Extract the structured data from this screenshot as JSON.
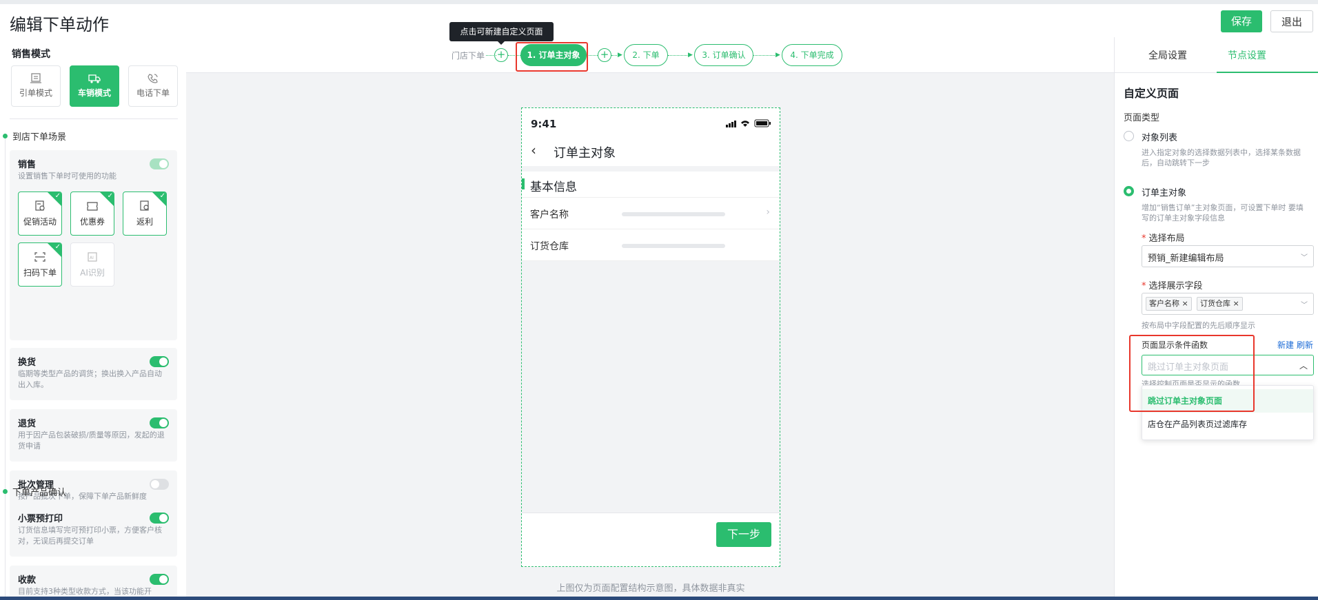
{
  "header": {
    "title": "编辑下单动作",
    "save_label": "保存",
    "exit_label": "退出"
  },
  "left": {
    "section_title": "销售模式",
    "modes": [
      {
        "label": "引单模式",
        "icon": "order-icon"
      },
      {
        "label": "车销模式",
        "icon": "truck-icon",
        "active": true
      },
      {
        "label": "电话下单",
        "icon": "phone-icon"
      }
    ],
    "scene1": "到店下单场景",
    "sales": {
      "title": "销售",
      "desc": "设置销售下单时可使用的功能",
      "features": [
        "促销活动",
        "优惠券",
        "返利",
        "扫码下单",
        "AI识别"
      ]
    },
    "exchange": {
      "title": "换货",
      "desc": "临期等类型产品的调货；换出换入产品自动出入库。",
      "on": true
    },
    "returns": {
      "title": "退货",
      "desc": "用于因产品包装破损/质量等原因，发起的退货申请",
      "on": true
    },
    "batch": {
      "title": "批次管理",
      "desc": "按产品批次下单，保障下单产品新鲜度",
      "on": false
    },
    "scene2": "下单产品确认",
    "receipt": {
      "title": "小票预打印",
      "desc": "订货信息填写完可预打印小票，方便客户核对，无误后再提交订单",
      "on": true
    },
    "collect": {
      "title": "收款",
      "desc": "目前支持3种类型收款方式，当该功能开",
      "on": true
    }
  },
  "steps": {
    "tooltip": "点击可新建自定义页面",
    "store": "门店下单",
    "items": [
      "1. 订单主对象",
      "2. 下单",
      "3. 订单确认",
      "4. 下单完成"
    ]
  },
  "phone": {
    "time": "9:41",
    "title": "订单主对象",
    "section": "基本信息",
    "rows": [
      "客户名称",
      "订货仓库"
    ],
    "next": "下一步"
  },
  "caption": "上图仅为页面配置结构示意图，具体数据非真实",
  "right": {
    "tabs": [
      "全局设置",
      "节点设置"
    ],
    "title": "自定义页面",
    "page_type_label": "页面类型",
    "opt1": {
      "label": "对象列表",
      "desc": "进入指定对象的选择数据列表中，选择某条数据后，自动跳转下一步"
    },
    "opt2": {
      "label": "订单主对象",
      "desc": "增加“销售订单”主对象页面，可设置下单时 要填写的订单主对象字段信息"
    },
    "layout_label": "选择布局",
    "layout_value": "预销_新建编辑布局",
    "fields_label": "选择展示字段",
    "fields": [
      "客户名称",
      "订货仓库"
    ],
    "fields_hint": "按布局中字段配置的先后顺序显示",
    "cond_label": "页面显示条件函数",
    "new_link": "新建",
    "refresh_link": "刷新",
    "cond_placeholder": "跳过订单主对象页面",
    "cond_hint": "选择控制页面是否显示的函数",
    "options": [
      "跳过订单主对象页面",
      "店仓在产品列表页过滤库存"
    ]
  },
  "colors": {
    "accent": "#2bbd6f",
    "highlight": "#e8362b"
  }
}
